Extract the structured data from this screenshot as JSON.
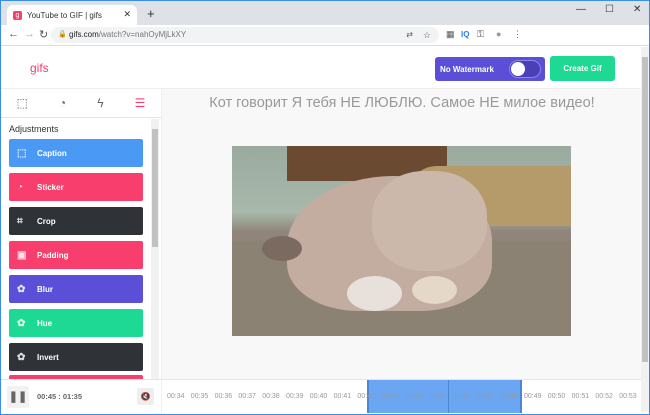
{
  "browser": {
    "tab_title": "YouTube to GIF | gifs",
    "favicon": "g",
    "url_host": "gifs.com",
    "url_path": "/watch?v=nahOyMjLkXY"
  },
  "header": {
    "logo": "gifs",
    "watermark_label": "No Watermark",
    "create_label": "Create Gif"
  },
  "sidebar": {
    "title": "Adjustments",
    "items": [
      {
        "label": "Caption",
        "color": "#4a9af5",
        "icon": "caption-icon",
        "glyph": "⬚"
      },
      {
        "label": "Sticker",
        "color": "#f73e6c",
        "icon": "sticker-icon",
        "glyph": "◔"
      },
      {
        "label": "Crop",
        "color": "#2f3338",
        "icon": "crop-icon",
        "glyph": "⌗"
      },
      {
        "label": "Padding",
        "color": "#f73e6c",
        "icon": "padding-icon",
        "glyph": "▣"
      },
      {
        "label": "Blur",
        "color": "#5b4fd8",
        "icon": "palette-icon",
        "glyph": "✿"
      },
      {
        "label": "Hue",
        "color": "#1ed993",
        "icon": "palette-icon",
        "glyph": "✿"
      },
      {
        "label": "Invert",
        "color": "#2f3338",
        "icon": "palette-icon",
        "glyph": "✿"
      }
    ]
  },
  "main": {
    "video_title": "Кот говорит Я тебя НЕ ЛЮБЛЮ. Самое НЕ милое видео!"
  },
  "timeline": {
    "current": "00:45 : 01:35",
    "ticks": [
      "00:34",
      "00:35",
      "00:36",
      "00:37",
      "00:38",
      "00:39",
      "00:40",
      "00:41",
      "00:42",
      "00:43",
      "00:44",
      "00:45",
      "00:46",
      "00:47",
      "00:48",
      "00:49",
      "00:50",
      "00:51",
      "00:52",
      "00:53"
    ]
  }
}
